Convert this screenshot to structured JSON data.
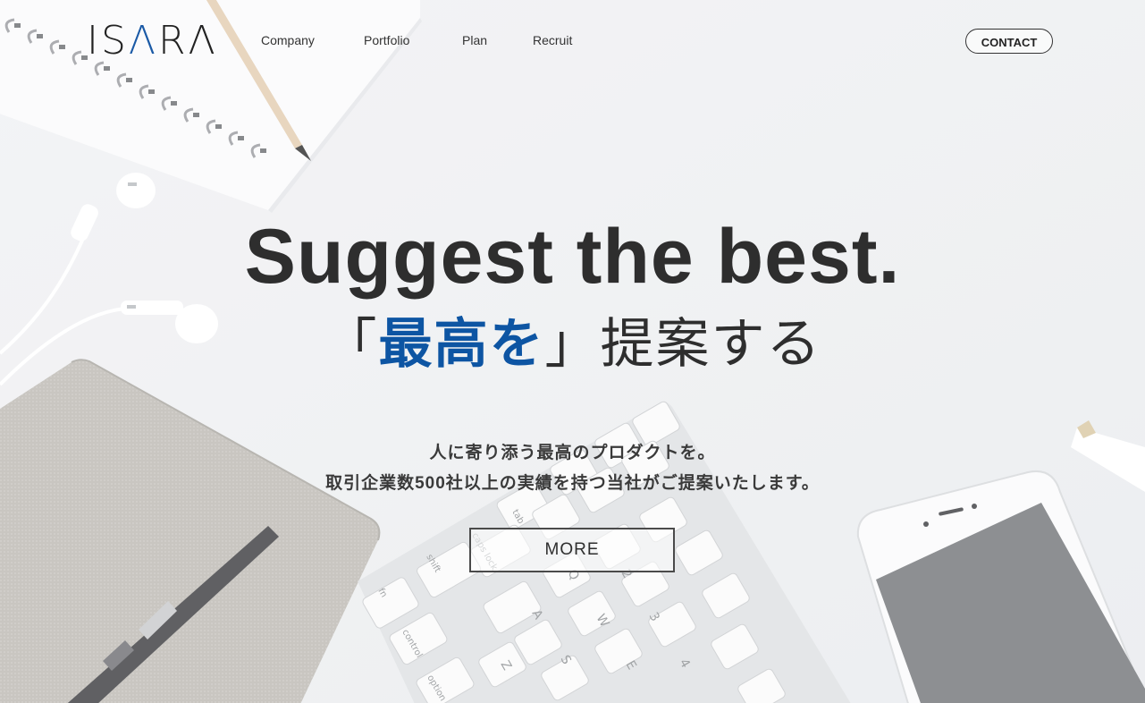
{
  "brand": {
    "logo_text_1": "IS",
    "logo_text_2": "Λ",
    "logo_text_3": "RΛ"
  },
  "nav": {
    "items": [
      {
        "label": "Company"
      },
      {
        "label": "Portfolio"
      },
      {
        "label": "Plan"
      },
      {
        "label": "Recruit"
      }
    ]
  },
  "header": {
    "contact_label": "CONTACT"
  },
  "hero": {
    "headline": "Suggest the best.",
    "sub_open": "「",
    "sub_accent": "最高を",
    "sub_close": "」",
    "sub_rest": "提案する",
    "desc_line1": "人に寄り添う最高のプロダクトを。",
    "desc_line2": "取引企業数500社以上の実績を持つ当社がご提案いたします。",
    "more_label": "MORE"
  },
  "background": {
    "icons": [
      "notebook-icon",
      "pencil-icon",
      "earphones-icon",
      "book-icon",
      "pen-icon",
      "keyboard-icon",
      "smartphone-icon"
    ],
    "keyboard_keys": [
      "tab",
      "caps lock",
      "shift",
      "fn",
      "control",
      "option",
      "Q",
      "A",
      "Z",
      "W",
      "S",
      "E",
      "2",
      "3",
      "4"
    ]
  },
  "colors": {
    "accent": "#0d55a3",
    "text": "#2e2e2e",
    "background": "#eef0f2"
  }
}
